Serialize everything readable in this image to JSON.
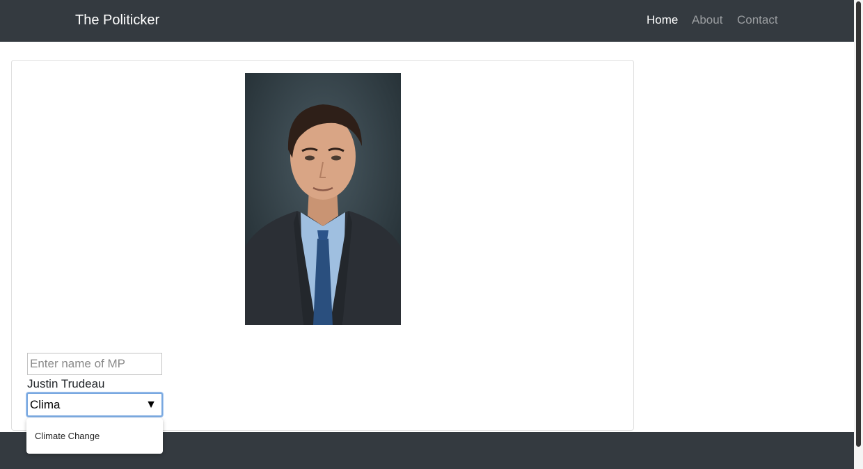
{
  "navbar": {
    "brand": "The Politicker",
    "links": [
      {
        "label": "Home",
        "active": true
      },
      {
        "label": "About",
        "active": false
      },
      {
        "label": "Contact",
        "active": false
      }
    ]
  },
  "search": {
    "placeholder": "Enter name of MP",
    "value": ""
  },
  "mp": {
    "name": "Justin Trudeau"
  },
  "topic_select": {
    "value": "Clima",
    "caret": "▼",
    "options": [
      "Climate Change"
    ]
  },
  "colors": {
    "navbar_bg": "#343a40",
    "focus_ring": "#79a8e0"
  }
}
